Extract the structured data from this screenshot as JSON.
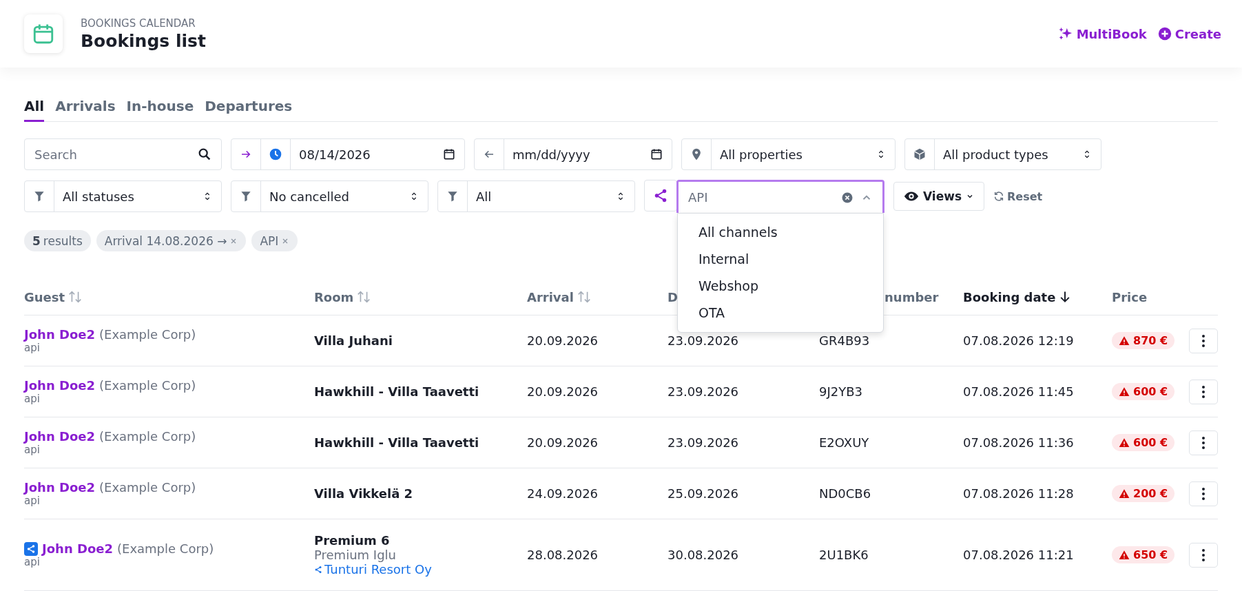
{
  "header": {
    "section": "BOOKINGS CALENDAR",
    "title": "Bookings list",
    "actions": [
      {
        "kind": "multibook",
        "label": "MultiBook"
      },
      {
        "kind": "create",
        "label": "Create"
      }
    ]
  },
  "tabs": [
    {
      "label": "All",
      "selected": true
    },
    {
      "label": "Arrivals",
      "selected": false
    },
    {
      "label": "In-house",
      "selected": false
    },
    {
      "label": "Departures",
      "selected": false
    }
  ],
  "filters": {
    "search": {
      "placeholder": "Search"
    },
    "arrival": {
      "value": "08/14/2026"
    },
    "departure": {
      "placeholder": "mm/dd/yyyy"
    },
    "property": {
      "value": "All properties"
    },
    "product_type": {
      "value": "All product types"
    },
    "status": {
      "value": "All statuses"
    },
    "cancelled": {
      "value": "No cancelled"
    },
    "filter_3": {
      "value": "All"
    },
    "channel": {
      "value": "API",
      "expanded": true,
      "options": [
        {
          "label": "All channels",
          "selected": false
        },
        {
          "label": "Internal",
          "selected": false
        },
        {
          "label": "Webshop",
          "selected": false
        },
        {
          "label": "OTA",
          "selected": false
        }
      ]
    },
    "views": {
      "label": "Views"
    },
    "reset": {
      "label": "Reset"
    }
  },
  "chips": {
    "results": "**5** results",
    "items": [
      {
        "label": "Arrival 14.08.2026 →"
      },
      {
        "label": "API"
      }
    ]
  },
  "table": {
    "columns": [
      {
        "label": "Guest",
        "kind": "sortable"
      },
      {
        "label": "Room",
        "kind": "sortable"
      },
      {
        "label": "Arrival",
        "kind": "sortable"
      },
      {
        "label": "D",
        "kind": "plain"
      },
      {
        "label": "number",
        "kind": "plain"
      },
      {
        "label": "Booking date",
        "kind": "sorted"
      },
      {
        "label": "Price",
        "kind": "plain"
      }
    ],
    "rows": [
      {
        "guest": "John Doe2",
        "company": "(Example Corp)",
        "source": "api",
        "shared": false,
        "room": {
          "name": "Villa Juhani"
        },
        "arrival": "20.09.2026",
        "departure": "23.09.2026",
        "booking_number": "GR4B93",
        "booking_date": "07.08.2026 12:19",
        "price": "870 €",
        "warning": true
      },
      {
        "guest": "John Doe2",
        "company": "(Example Corp)",
        "source": "api",
        "shared": false,
        "room": {
          "name": "Hawkhill - Villa Taavetti"
        },
        "arrival": "20.09.2026",
        "departure": "23.09.2026",
        "booking_number": "9J2YB3",
        "booking_date": "07.08.2026 11:45",
        "price": "600 €",
        "warning": true
      },
      {
        "guest": "John Doe2",
        "company": "(Example Corp)",
        "source": "api",
        "shared": false,
        "room": {
          "name": "Hawkhill - Villa Taavetti"
        },
        "arrival": "20.09.2026",
        "departure": "23.09.2026",
        "booking_number": "E2OXUY",
        "booking_date": "07.08.2026 11:36",
        "price": "600 €",
        "warning": true
      },
      {
        "guest": "John Doe2",
        "company": "(Example Corp)",
        "source": "api",
        "shared": false,
        "room": {
          "name": "Villa Vikkelä 2"
        },
        "arrival": "24.09.2026",
        "departure": "25.09.2026",
        "booking_number": "ND0CB6",
        "booking_date": "07.08.2026 11:28",
        "price": "200 €",
        "warning": true
      },
      {
        "guest": "John Doe2",
        "company": "(Example Corp)",
        "source": "api",
        "shared": true,
        "room": {
          "name": "Premium 6",
          "subtitle": "Premium Iglu",
          "link": "Tunturi Resort Oy"
        },
        "arrival": "28.08.2026",
        "departure": "30.08.2026",
        "booking_number": "2U1BK6",
        "booking_date": "07.08.2026 11:21",
        "price": "650 €",
        "warning": true
      }
    ]
  }
}
